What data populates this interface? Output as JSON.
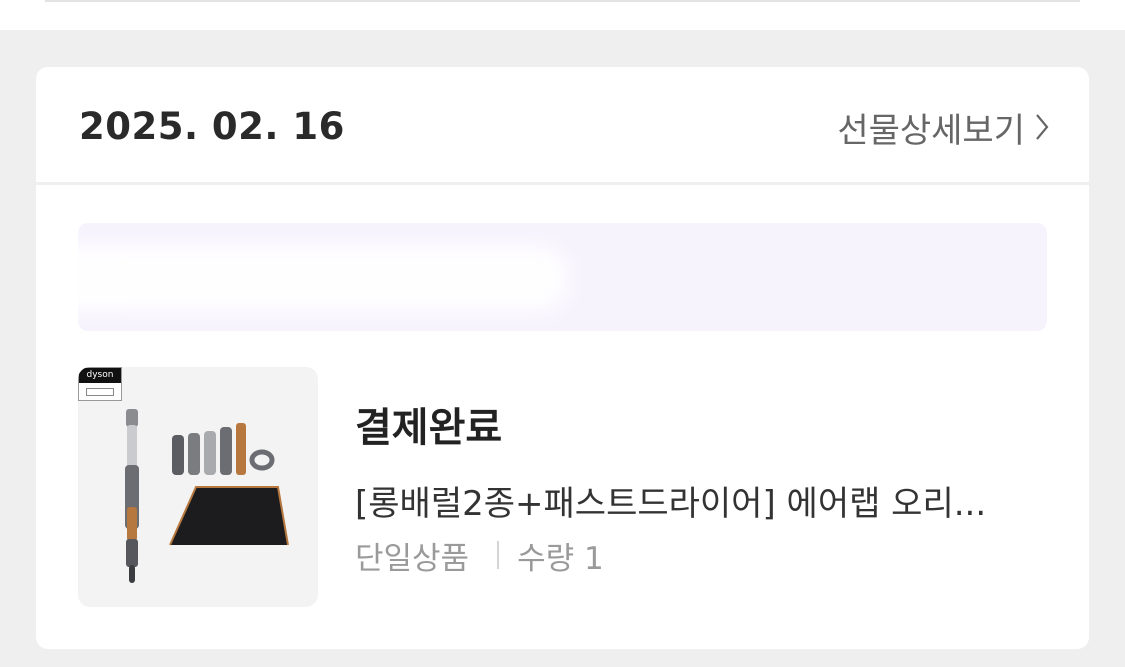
{
  "order": {
    "date": "2025. 02. 16",
    "detail_link_label": "선물상세보기",
    "detail_link_icon": "chevron-right-icon"
  },
  "brand_badge": {
    "label": "dyson"
  },
  "item": {
    "status": "결제완료",
    "product_name": "[롱배럴2종+패스트드라이어] 에어랩 오리...",
    "option": "단일상품",
    "quantity_label": "수량 1"
  },
  "colors": {
    "background": "#efefef",
    "card": "#ffffff",
    "banner": "#f7f3fd",
    "copper": "#b77840",
    "nickel": "#6b6d72"
  }
}
